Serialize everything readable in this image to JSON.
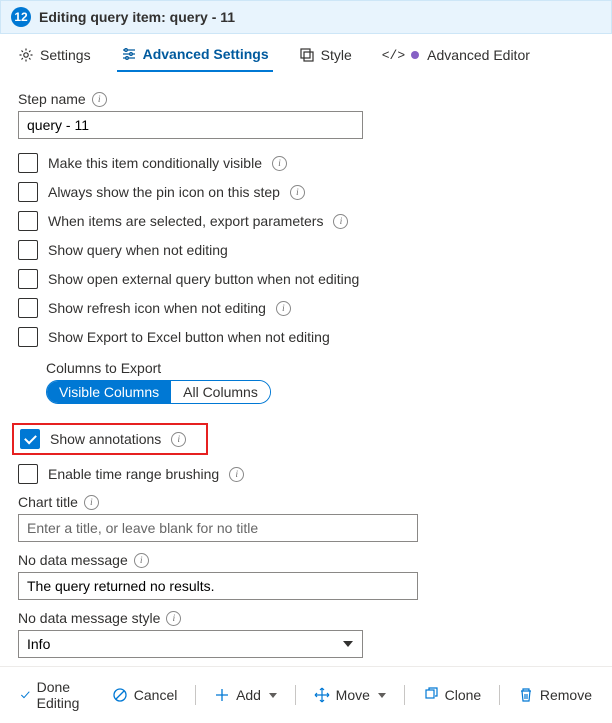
{
  "header": {
    "badge": "12",
    "title": "Editing query item: query - 11"
  },
  "tabs": {
    "settings": "Settings",
    "advanced": "Advanced Settings",
    "style": "Style",
    "advanced_editor": "Advanced Editor"
  },
  "stepName": {
    "label": "Step name",
    "value": "query - 11"
  },
  "checks": {
    "conditional": "Make this item conditionally visible",
    "pin": "Always show the pin icon on this step",
    "export_params": "When items are selected, export parameters",
    "show_query": "Show query when not editing",
    "show_external": "Show open external query button when not editing",
    "show_refresh": "Show refresh icon when not editing",
    "show_excel": "Show Export to Excel button when not editing"
  },
  "columnsToExport": {
    "label": "Columns to Export",
    "visible": "Visible Columns",
    "all": "All Columns"
  },
  "showAnnotations": "Show annotations",
  "timeBrushing": "Enable time range brushing",
  "chartTitle": {
    "label": "Chart title",
    "placeholder": "Enter a title, or leave blank for no title",
    "value": ""
  },
  "noDataMsg": {
    "label": "No data message",
    "value": "The query returned no results."
  },
  "noDataStyle": {
    "label": "No data message style",
    "value": "Info"
  },
  "footer": {
    "done": "Done Editing",
    "cancel": "Cancel",
    "add": "Add",
    "move": "Move",
    "clone": "Clone",
    "remove": "Remove"
  }
}
